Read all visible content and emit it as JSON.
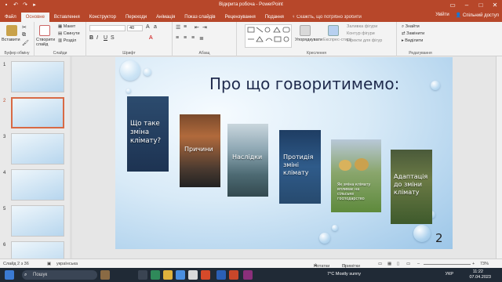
{
  "window": {
    "title": "Відкрита робоча - PowerPoint",
    "user": "Увійти",
    "share": "Спільний доступ"
  },
  "tabs": [
    "Файл",
    "Основне",
    "Вставлення",
    "Конструктор",
    "Переходи",
    "Анімація",
    "Показ слайдів",
    "Рецензування",
    "Подання"
  ],
  "active_tab": "Основне",
  "tell_me": "Скажіть, що потрібно зробити",
  "ribbon": {
    "clipboard": {
      "paste": "Вставити",
      "label": "Буфер обміну"
    },
    "slides": {
      "new_slide": "Створити слайд",
      "layout": "Макет",
      "reset": "Скинути",
      "section": "Розділ",
      "label": "Слайди"
    },
    "font": {
      "size": "40",
      "label": "Шрифт"
    },
    "paragraph": {
      "label": "Абзац"
    },
    "drawing": {
      "arrange": "Упорядкувати",
      "quick_styles": "Експрес-стилі",
      "fill": "Заливка фігури",
      "outline": "Контур фігури",
      "effects": "Ефекти для фігур",
      "label": "Креслення"
    },
    "editing": {
      "find": "Знайти",
      "replace": "Замінити",
      "select": "Виділити",
      "label": "Редагування"
    }
  },
  "thumbnails": [
    {
      "num": "1"
    },
    {
      "num": "2"
    },
    {
      "num": "3"
    },
    {
      "num": "4"
    },
    {
      "num": "5"
    },
    {
      "num": "6"
    }
  ],
  "slide": {
    "title": "Про що говоритимемо:",
    "number": "2",
    "cards": [
      {
        "label": "Що таке зміна клімату?"
      },
      {
        "label": "Причини"
      },
      {
        "label": "Наслідки"
      },
      {
        "label": "Протидія зміні клімату"
      },
      {
        "label": "Як зміна клімату впливає на сільське господарство"
      },
      {
        "label": "Адаптація до зміни клімату"
      }
    ]
  },
  "status": {
    "slide_of": "Слайд 2 з 36",
    "language": "українська",
    "notes": "Нотатки",
    "comments": "Примітки",
    "zoom": "73%"
  },
  "taskbar": {
    "search": "Пошук",
    "weather": "7°C  Mostly sunny",
    "lang": "УКР",
    "time": "11:22",
    "date": "07.04.2023"
  },
  "colors": {
    "accent": "#b7472a",
    "title": "#1f2a4d",
    "slide_bg": "#cfe3f3"
  }
}
